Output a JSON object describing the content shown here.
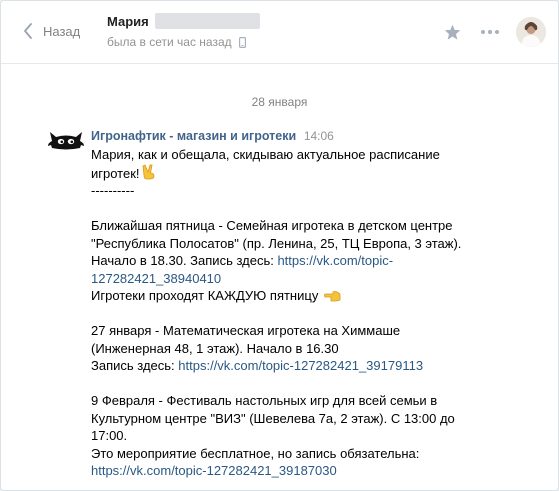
{
  "header": {
    "back_label": "Назад",
    "user_name": "Мария",
    "status": "была в сети час назад"
  },
  "chat": {
    "date": "28 января",
    "message": {
      "author": "Игронафтик - магазин и игротеки",
      "time": "14:06",
      "lines": {
        "l1": "Мария, как и обещала, скидываю актуальное расписание",
        "l2": "игротек!",
        "l3": "----------",
        "l4": "Ближайшая пятница - Семейная игротека в детском центре",
        "l5": "\"Республика Полосатов\" (пр. Ленина, 25, ТЦ Европа, 3 этаж).",
        "l6": "Начало в 18.30. Запись здесь:",
        "l6_link": "https://vk.com/topic-",
        "l7_link": "127282421_38940410",
        "l8": "Игротеки проходят КАЖДУЮ пятницу",
        "l9": "27 января - Математическая игротека на Химмаше",
        "l10": "(Инженерная 48, 1 этаж). Начало в 16.30",
        "l11": "Запись здесь:",
        "l11_link": "https://vk.com/topic-127282421_39179113",
        "l12": "9 Февраля - Фестиваль настольных игр для всей семьи в",
        "l13": "Культурном центре \"ВИЗ\" (Шевелева 7а, 2 этаж). С 13:00 до",
        "l14": "17:00.",
        "l15": "Это мероприятие бесплатное, но запись обязательна:",
        "l16_link": "https://vk.com/topic-127282421_39187030"
      }
    }
  },
  "colors": {
    "link": "#2a5885",
    "author": "#42648b",
    "muted": "#939393"
  },
  "icons": {
    "back": "chevron-left-icon",
    "star": "star-icon",
    "more": "more-dots-icon",
    "phone": "mobile-phone-icon",
    "sender_avatar": "black-cat-logo",
    "victory": "victory-hand-emoji",
    "point_left": "pointing-left-hand-emoji"
  }
}
